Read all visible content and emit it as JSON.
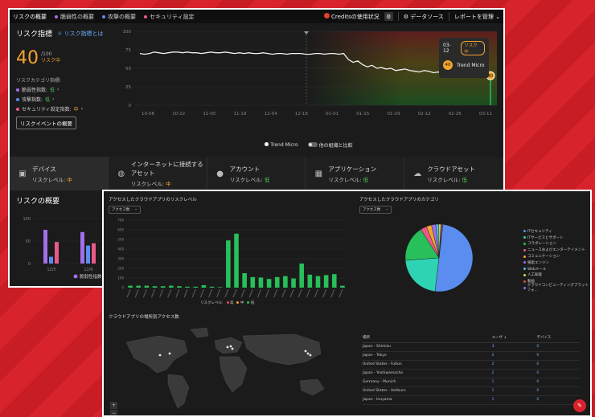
{
  "top": {
    "tabs": [
      {
        "label": "リスクの概要",
        "color": ""
      },
      {
        "label": "脆弱性の概要",
        "color": "#a070e8"
      },
      {
        "label": "攻撃の概要",
        "color": "#5b8df0"
      },
      {
        "label": "セキュリティ設定",
        "color": "#e85a8a"
      }
    ],
    "credits": "Creditsの使用状況",
    "datasource": "データソース",
    "report": "レポートを管理"
  },
  "risk": {
    "title": "リスク指標",
    "link": "リスク指標とは",
    "score": "40",
    "max": "/100",
    "level": "リスク中",
    "category_title": "リスクカテゴリ指標:",
    "categories": [
      {
        "label": "脆弱性指数:",
        "level": "低",
        "color": "#a070e8"
      },
      {
        "label": "攻撃指数:",
        "level": "低",
        "color": "#5b8df0"
      },
      {
        "label": "セキュリティ設定指数:",
        "level": "中",
        "color": "#e85a8a"
      }
    ],
    "event_button": "リスクイベントの概要"
  },
  "trend": {
    "yticks": [
      "100",
      "75",
      "50",
      "25",
      "0"
    ],
    "xticks": [
      "10-08",
      "10-22",
      "11-05",
      "11-19",
      "12-04",
      "12-18",
      "01-01",
      "01-15",
      "01-29",
      "02-12",
      "02-26",
      "03-11"
    ],
    "legend_self": "Trend Micro",
    "legend_compare": "他の組織と比較",
    "tooltip": {
      "date": "03-12",
      "badge": "リスク中",
      "score": "40",
      "name": "Trend Micro"
    },
    "end_label": "40",
    "values": [
      70,
      69,
      70,
      72,
      71,
      70,
      71,
      72,
      72,
      71,
      72,
      71,
      71,
      70,
      71,
      72,
      71,
      71,
      72,
      71,
      70,
      71,
      70,
      71,
      70,
      70,
      71,
      70,
      69,
      70,
      70,
      69,
      70,
      70,
      70,
      69,
      69,
      70,
      70,
      69,
      70,
      70,
      69,
      70,
      62,
      58,
      60,
      55,
      52,
      54,
      50,
      51,
      49,
      50,
      47,
      48,
      49,
      47,
      46,
      45,
      47,
      46,
      44,
      45,
      42,
      44,
      46,
      43,
      42,
      44,
      45,
      43,
      46,
      45,
      40
    ]
  },
  "cards": [
    {
      "name": "デバイス",
      "level_label": "リスクレベル:",
      "level": "中",
      "icon": "device-icon"
    },
    {
      "name": "インターネットに接続するアセット",
      "level_label": "リスクレベル:",
      "level": "中",
      "icon": "globe-icon"
    },
    {
      "name": "アカウント",
      "level_label": "リスクレベル:",
      "level": "低",
      "icon": "user-icon"
    },
    {
      "name": "アプリケーション",
      "level_label": "リスクレベル:",
      "level": "低",
      "icon": "apps-icon"
    },
    {
      "name": "クラウドアセット",
      "level_label": "リスクレベル:",
      "level": "低",
      "icon": "cloud-icon"
    }
  ],
  "overview": {
    "title": "リスクの概要",
    "yticks": [
      "100",
      "50",
      "0"
    ],
    "xticks": [
      "12/5",
      "12/6"
    ],
    "legend": "脆弱性指数"
  },
  "cloud_risk": {
    "title": "アクセスしたクラウドアプリのリスクレベル",
    "select": "アクセス数",
    "legend_label": "リスクレベル:",
    "legend": [
      {
        "label": "高",
        "color": "#e8483b"
      },
      {
        "label": "中",
        "color": "#f2a42d"
      },
      {
        "label": "低",
        "color": "#27c05a"
      }
    ]
  },
  "cloud_category": {
    "title": "アクセスしたクラウドアプリのカテゴリ",
    "select": "アクセス数",
    "legend": [
      {
        "label": "ITセキュリティ",
        "color": "#5b8df0"
      },
      {
        "label": "ITサービスとサポート",
        "color": "#2ed3b3"
      },
      {
        "label": "コラボレーション",
        "color": "#27c05a"
      },
      {
        "label": "ニュースおよびエンターテイメント",
        "color": "#e85a8a"
      },
      {
        "label": "コミュニケーション",
        "color": "#f2a42d"
      },
      {
        "label": "検索エンジン",
        "color": "#a070e8"
      },
      {
        "label": "Webメール",
        "color": "#4fb6e8"
      },
      {
        "label": "人工知能",
        "color": "#c2e04d"
      },
      {
        "label": "動画",
        "color": "#e8483b"
      },
      {
        "label": "クラウドコンピューティングプラットフォ...",
        "color": "#8a6de8"
      }
    ]
  },
  "map": {
    "title": "クラウドアプリの場所別アクセス数",
    "zoom_in": "+",
    "zoom_out": "−"
  },
  "table": {
    "headers": [
      "場所",
      "ユーザ ↓",
      "デバイス"
    ],
    "rows": [
      [
        "Japan - Shimizu",
        "3",
        "0"
      ],
      [
        "Japan - Tokyo",
        "2",
        "0"
      ],
      [
        "United States - Fulton",
        "2",
        "0"
      ],
      [
        "Japan - Yoshiwamacho",
        "2",
        "0"
      ],
      [
        "Germany - Munich",
        "1",
        "0"
      ],
      [
        "United States - Ashburn",
        "1",
        "0"
      ],
      [
        "Japan - Inuyama",
        "1",
        "0"
      ]
    ]
  },
  "chart_data": [
    {
      "type": "line",
      "title": "",
      "x": [
        "10-08",
        "10-22",
        "11-05",
        "11-19",
        "12-04",
        "12-18",
        "01-01",
        "01-15",
        "01-29",
        "02-12",
        "02-26",
        "03-11"
      ],
      "series": [
        {
          "name": "Trend Micro",
          "values": [
            70,
            71,
            72,
            71,
            70,
            70,
            62,
            50,
            47,
            44,
            43,
            40
          ]
        }
      ],
      "ylim": [
        0,
        100
      ]
    },
    {
      "type": "bar",
      "title": "アクセスしたクラウドアプリのリスクレベル",
      "values": [
        20,
        20,
        20,
        15,
        15,
        20,
        15,
        10,
        10,
        25,
        10,
        5,
        490,
        560,
        150,
        110,
        105,
        90,
        110,
        120,
        95,
        250,
        135,
        120,
        130,
        140,
        20
      ],
      "colors": [
        "#27c05a"
      ],
      "ylim": [
        0,
        700
      ]
    },
    {
      "type": "pie",
      "title": "アクセスしたクラウドアプリのカテゴリ",
      "values": [
        50,
        22,
        17,
        3,
        2.5,
        2,
        1.5,
        1,
        0.5,
        0.5
      ]
    },
    {
      "type": "bar",
      "title": "リスクの概要",
      "categories": [
        "12/5",
        "12/6"
      ],
      "series": [
        {
          "values": [
            75,
            15,
            48
          ]
        },
        {
          "values": [
            70,
            40,
            45
          ]
        }
      ],
      "ylim": [
        0,
        100
      ]
    }
  ]
}
